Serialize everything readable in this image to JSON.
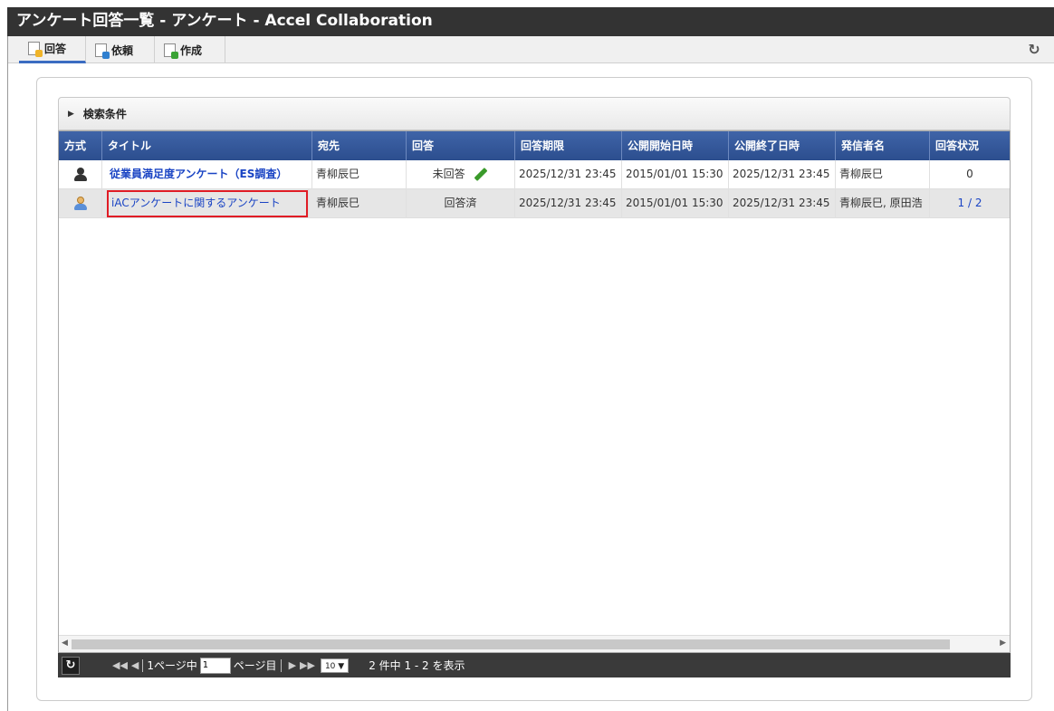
{
  "window": {
    "title": "アンケート回答一覧 - アンケート - Accel Collaboration"
  },
  "tabs": [
    {
      "label": "回答",
      "icon": "answer-doc-icon",
      "active": true
    },
    {
      "label": "依頼",
      "icon": "request-doc-icon",
      "active": false
    },
    {
      "label": "作成",
      "icon": "create-doc-icon",
      "active": false
    }
  ],
  "search": {
    "label": "検索条件"
  },
  "table": {
    "headers": [
      "方式",
      "タイトル",
      "宛先",
      "回答",
      "回答期限",
      "公開開始日時",
      "公開終了日時",
      "発信者名",
      "回答状況"
    ],
    "rows": [
      {
        "method_icon": "anonymous-user-icon",
        "title": "従業員満足度アンケート（ES調査）",
        "recipient": "青柳辰巳",
        "answer": "未回答",
        "deadline": "2025/12/31 23:45",
        "start": "2015/01/01 15:30",
        "end": "2025/12/31 23:45",
        "sender": "青柳辰巳",
        "status": "0"
      },
      {
        "method_icon": "named-user-icon",
        "title": "iACアンケートに関するアンケート",
        "recipient": "青柳辰巳",
        "answer": "回答済",
        "deadline": "2025/12/31 23:45",
        "start": "2015/01/01 15:30",
        "end": "2025/12/31 23:45",
        "sender": "青柳辰巳, 原田浩",
        "status": "1 / 2"
      }
    ]
  },
  "pager": {
    "page_prefix": "1ページ中",
    "page_value": "1",
    "page_suffix": "ページ目",
    "per_page": "10 ▼",
    "summary": "2 件中 1 - 2 を表示"
  },
  "colors": {
    "header_bg": "#2c4e8e",
    "link": "#1a44c4",
    "highlight_box": "#e01c25"
  }
}
